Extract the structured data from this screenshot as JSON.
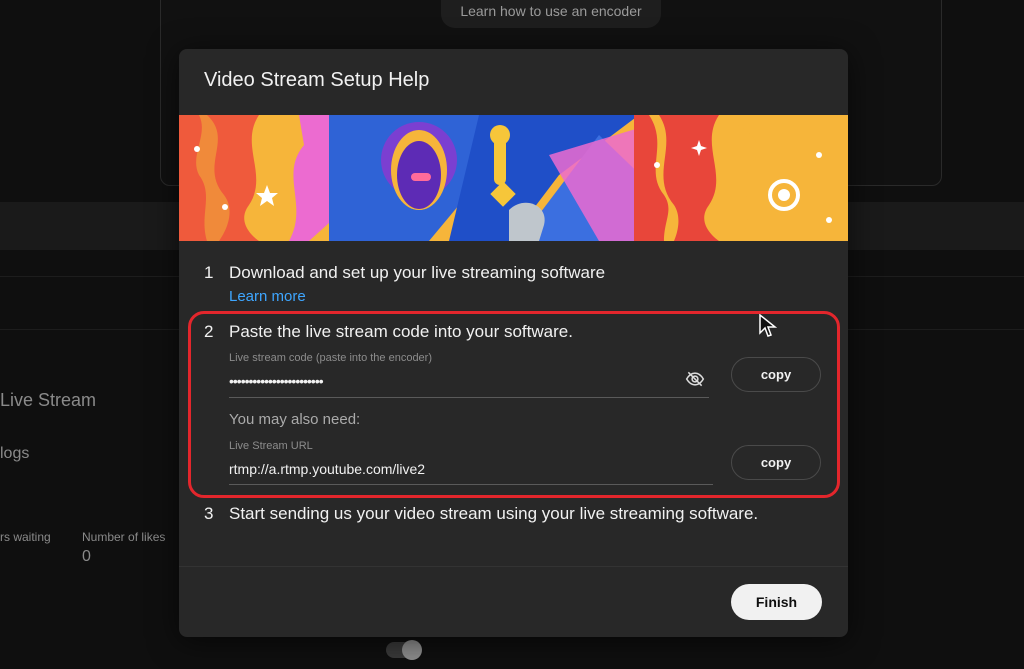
{
  "background": {
    "encoder_link": "Learn how to use an encoder",
    "live_stream": "Live Stream",
    "logs": "logs",
    "viewers_waiting": "rs waiting",
    "likes_label": "Number of likes",
    "likes_value": "0"
  },
  "dialog": {
    "title": "Video Stream Setup Help",
    "steps": [
      {
        "num": "1",
        "text": "Download and set up your live streaming software",
        "link": "Learn more"
      },
      {
        "num": "2",
        "text": "Paste the live stream code into your software."
      },
      {
        "num": "3",
        "text": "Start sending us your video stream using your live streaming software."
      }
    ],
    "stream_key": {
      "label": "Live stream code (paste into the encoder)",
      "value": "••••••••••••••••••••••••",
      "copy": "copy"
    },
    "also_need": "You may also need:",
    "stream_url": {
      "label": "Live Stream URL",
      "value": "rtmp://a.rtmp.youtube.com/live2",
      "copy": "copy"
    },
    "finish": "Finish"
  },
  "colors": {
    "highlight": "#e3262c",
    "link": "#3ea6ff"
  }
}
